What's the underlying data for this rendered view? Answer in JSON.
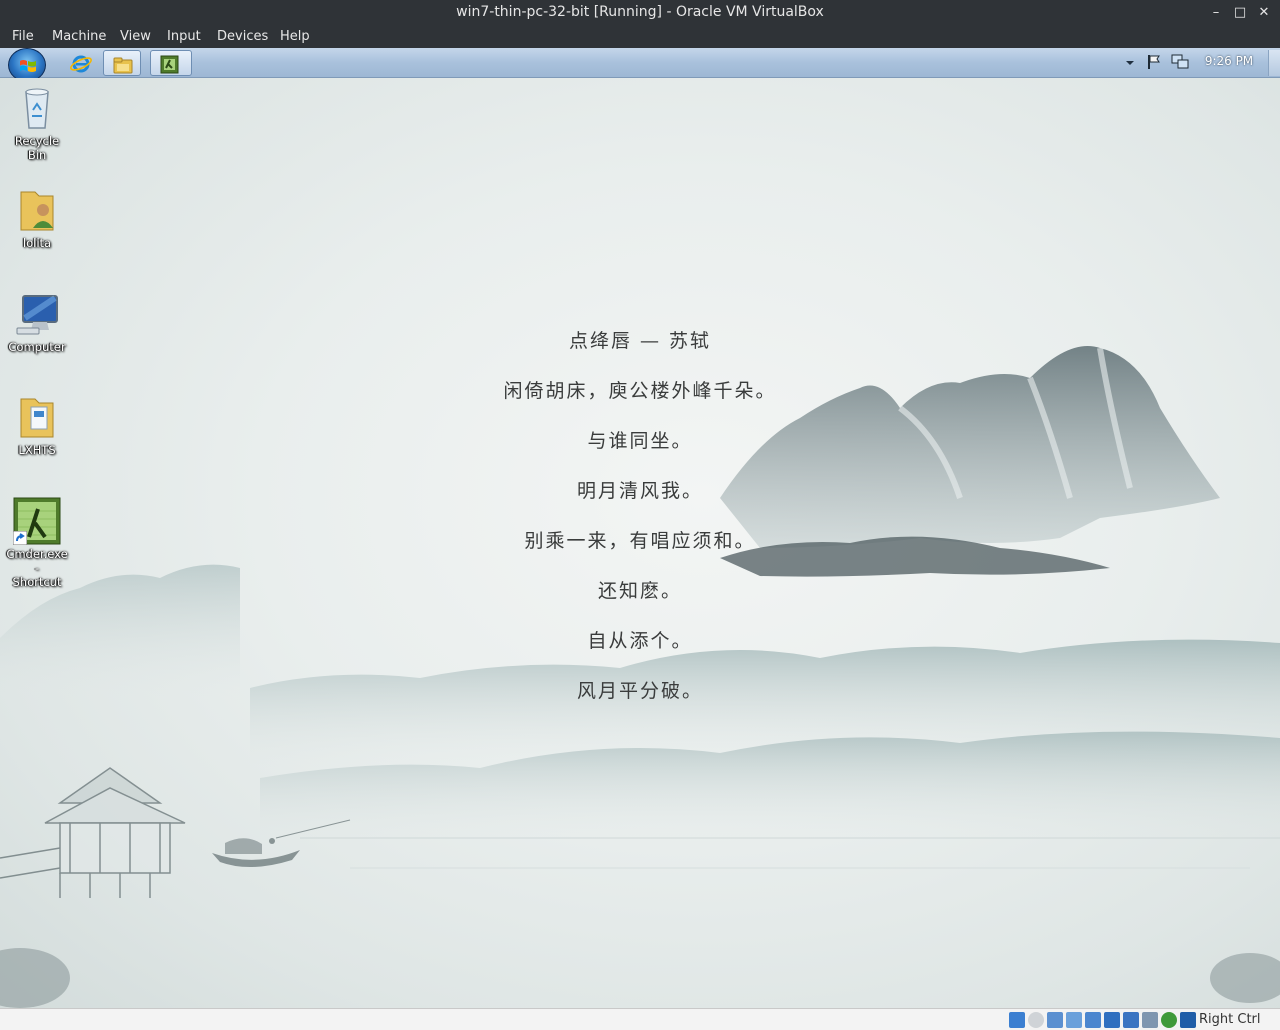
{
  "window": {
    "title": "win7-thin-pc-32-bit [Running] - Oracle VM VirtualBox",
    "minimize": "–",
    "maximize": "□",
    "close": "✕"
  },
  "menu": [
    "File",
    "Machine",
    "View",
    "Input",
    "Devices",
    "Help"
  ],
  "taskbar": {
    "pinned": [
      "internet-explorer-icon",
      "windows-explorer-icon",
      "cmder-task-icon"
    ],
    "clock": "9:26 PM"
  },
  "desktop_icons": [
    {
      "name": "recycle-bin",
      "label": "Recycle Bin"
    },
    {
      "name": "user-folder",
      "label": "lolita"
    },
    {
      "name": "computer",
      "label": "Computer"
    },
    {
      "name": "lxhts-folder",
      "label": "LXHTS"
    },
    {
      "name": "cmder-shortcut",
      "label_line1": "Cmder.exe -",
      "label_line2": "Shortcut"
    }
  ],
  "poem": {
    "title": "点绛唇 — 苏轼",
    "lines": [
      "闲倚胡床，庾公楼外峰千朵。",
      "与谁同坐。",
      "明月清风我。",
      "别乘一来，有唱应须和。",
      "还知麽。",
      "自从添个。",
      "风月平分破。"
    ]
  },
  "statusbar": {
    "host_key": "Right Ctrl"
  }
}
